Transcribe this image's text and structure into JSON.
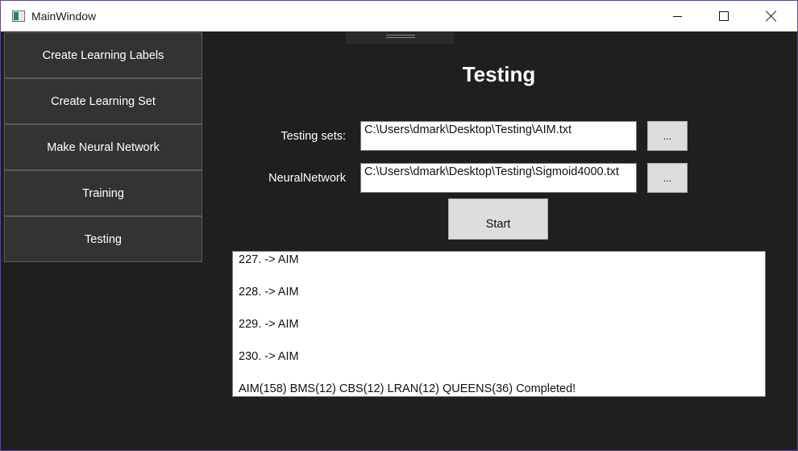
{
  "window": {
    "title": "MainWindow",
    "minimize_label": "minimize",
    "maximize_label": "maximize",
    "close_label": "close"
  },
  "sidebar": {
    "items": [
      {
        "label": "Create Learning Labels"
      },
      {
        "label": "Create Learning Set"
      },
      {
        "label": "Make Neural Network"
      },
      {
        "label": "Training"
      },
      {
        "label": "Testing"
      }
    ]
  },
  "main": {
    "title": "Testing",
    "testing_sets": {
      "label": "Testing sets:",
      "value": "C:\\Users\\dmark\\Desktop\\Testing\\AIM.txt",
      "browse_label": "..."
    },
    "neural_network": {
      "label": "NeuralNetwork",
      "value": "C:\\Users\\dmark\\Desktop\\Testing\\Sigmoid4000.txt",
      "browse_label": "..."
    },
    "start_label": "Start",
    "output_lines": [
      "227. -> AIM",
      "228. -> AIM",
      "229. -> AIM",
      "230. -> AIM",
      "AIM(158) BMS(12) CBS(12) LRAN(12) QUEENS(36) Completed!"
    ]
  },
  "colors": {
    "background": "#1f1f1f",
    "nav_button": "#333333",
    "light_button": "#dddddd",
    "window_border": "#5a4a8a"
  }
}
